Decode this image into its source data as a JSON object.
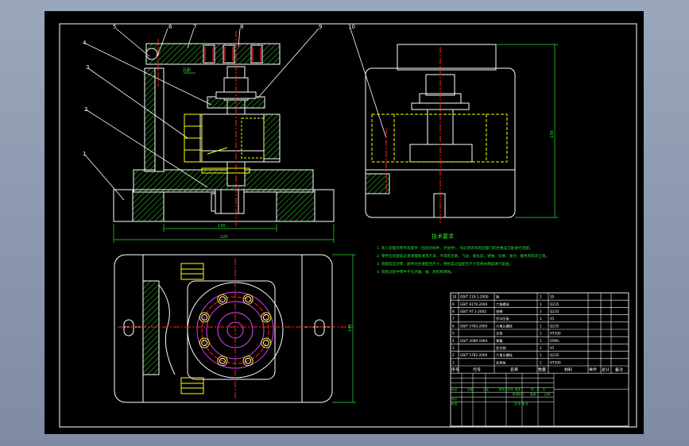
{
  "colors": {
    "background": "#000000",
    "outline": "#ffffff",
    "hatch": "#2ee02e",
    "center": "#ff2020",
    "hidden": "#ffff00",
    "gray": "#a0a0a0",
    "magenta": "#e040ff"
  },
  "balloons": [
    "1",
    "2",
    "3",
    "4",
    "5",
    "6",
    "7",
    "8",
    "9",
    "10"
  ],
  "dimensions": {
    "front_width_outer": "220",
    "front_width_inner": "130",
    "top_height": "148",
    "side_height": "130",
    "slot": "孔距"
  },
  "tech": {
    "title": "技术要求",
    "lines": [
      "1. 装入装配的零件及部件（包括外购件、外协件），均必须具有检验部门的合格证方能进行装配。",
      "2. 零件在装配前必须清理和清洗干净，不得有毛刺、飞边、氧化皮、锈蚀、切屑、油污、着色剂和灰尘等。",
      "3. 装配前应对零、部件的主要配合尺寸，特别是过盈配合尺寸及相关精度进行复查。",
      "4. 装配过程中零件不允许磕、碰、划伤和锈蚀。"
    ]
  },
  "bom": {
    "rows": [
      {
        "no": "10",
        "code": "GB/T 119.1-2000",
        "name": "销",
        "qty": "2",
        "mat": "35"
      },
      {
        "no": "9",
        "code": "GB/T 6170-2000",
        "name": "六角螺母",
        "qty": "1",
        "mat": "Q235"
      },
      {
        "no": "8",
        "code": "GB/T 97.1-2002",
        "name": "垫圈",
        "qty": "2",
        "mat": "Q235"
      },
      {
        "no": "7",
        "code": "",
        "name": "开口压板",
        "qty": "1",
        "mat": "45"
      },
      {
        "no": "6",
        "code": "GB/T 5783-2000",
        "name": "六角头螺栓",
        "qty": "1",
        "mat": "Q235"
      },
      {
        "no": "5",
        "code": "",
        "name": "支架",
        "qty": "1",
        "mat": "HT200"
      },
      {
        "no": "4",
        "code": "GB/T 2089-1994",
        "name": "弹簧",
        "qty": "1",
        "mat": "65Mn"
      },
      {
        "no": "3",
        "code": "",
        "name": "定位销",
        "qty": "1",
        "mat": "45"
      },
      {
        "no": "2",
        "code": "GB/T 5782-2000",
        "name": "六角头螺栓",
        "qty": "1",
        "mat": "Q235"
      },
      {
        "no": "1",
        "code": "",
        "name": "夹具体",
        "qty": "1",
        "mat": "HT200"
      }
    ],
    "header": {
      "no": "序号",
      "code": "代号",
      "name": "名称",
      "qty": "数量",
      "mat": "材料",
      "unit_mass": "单件",
      "total_mass": "总计",
      "mass": "质量",
      "remark": "备注"
    },
    "title_block": {
      "labels": [
        "标记",
        "处数",
        "分区",
        "更改文件号",
        "签名",
        "年、月、日"
      ],
      "design": "设计",
      "approve": "批准",
      "stage": "阶段标记",
      "weight": "重量",
      "scale": "比例",
      "sheet": "共 张 第 张"
    }
  }
}
